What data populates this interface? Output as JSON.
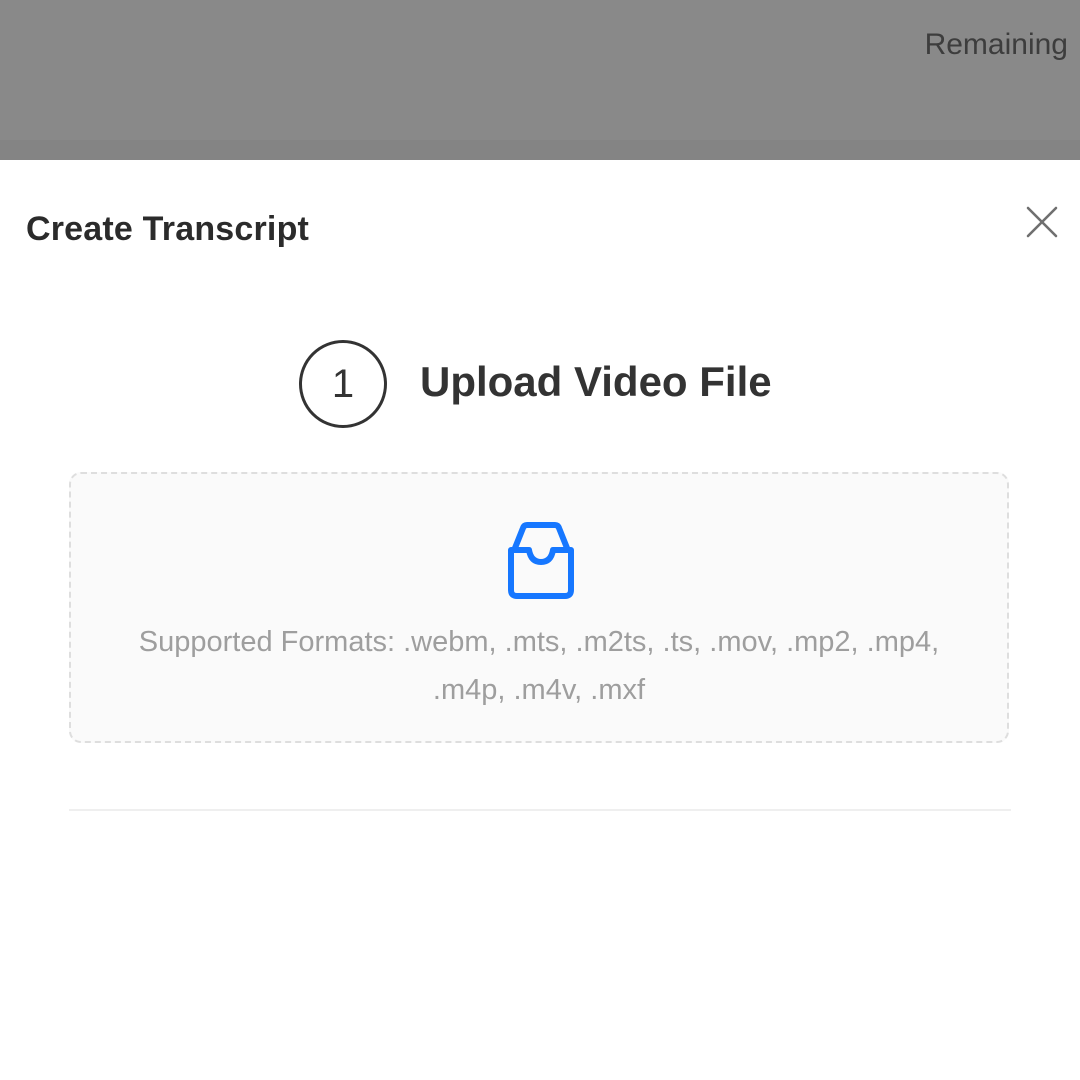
{
  "background": {
    "remaining_label": "Remaining"
  },
  "modal": {
    "title": "Create Transcript",
    "close_icon": "close-icon",
    "step": {
      "number": "1",
      "title": "Upload Video File"
    },
    "dropzone": {
      "icon": "inbox-icon",
      "supported_formats": "Supported Formats: .webm, .mts, .m2ts, .ts, .mov, .mp2, .mp4, .m4p, .m4v, .mxf"
    }
  },
  "colors": {
    "overlay": "#898989",
    "accent": "#1677ff",
    "text_primary": "#333333",
    "text_secondary": "#9e9e9e"
  }
}
